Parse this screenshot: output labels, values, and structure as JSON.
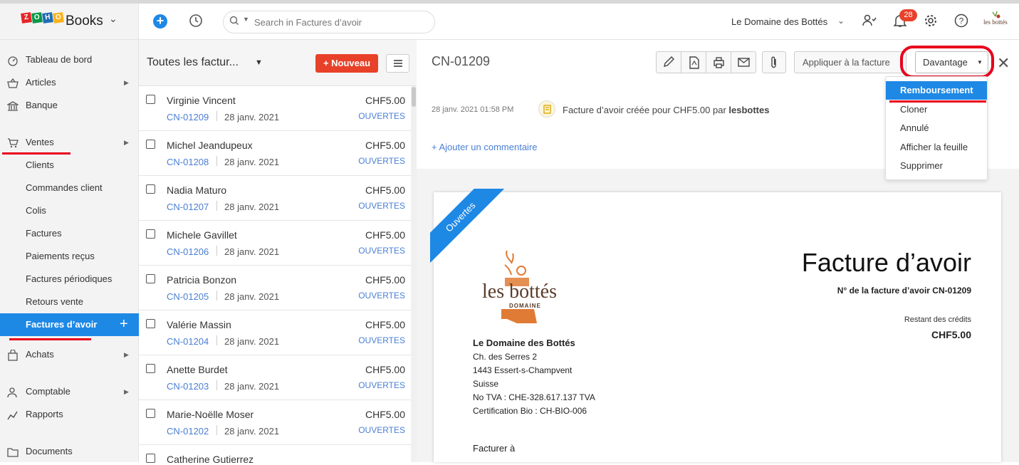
{
  "app": {
    "brand_letters": [
      "Z",
      "O",
      "H",
      "O"
    ],
    "brand_colors": [
      "#e42527",
      "#089949",
      "#226db4",
      "#f9b21d"
    ],
    "product": "Books"
  },
  "topbar": {
    "search_placeholder": "Search in Factures d’avoir",
    "org_name": "Le Domaine des Bottés",
    "notifications": "28",
    "avatar_label": "les bottés"
  },
  "sidebar": {
    "items": [
      {
        "label": "Tableau de bord"
      },
      {
        "label": "Articles"
      },
      {
        "label": "Banque"
      },
      {
        "label": "Ventes"
      },
      {
        "label": "Clients"
      },
      {
        "label": "Commandes client"
      },
      {
        "label": "Colis"
      },
      {
        "label": "Factures"
      },
      {
        "label": "Paiements reçus"
      },
      {
        "label": "Factures périodiques"
      },
      {
        "label": "Retours vente"
      },
      {
        "label": "Factures d’avoir"
      },
      {
        "label": "Achats"
      },
      {
        "label": "Comptable"
      },
      {
        "label": "Rapports"
      },
      {
        "label": "Documents"
      }
    ]
  },
  "list": {
    "title": "Toutes les factur...",
    "new_label": "+ Nouveau",
    "rows": [
      {
        "name": "Virginie Vincent",
        "number": "CN-01209",
        "date": "28 janv. 2021",
        "amount": "CHF5.00",
        "status": "OUVERTES"
      },
      {
        "name": "Michel Jeandupeux",
        "number": "CN-01208",
        "date": "28 janv. 2021",
        "amount": "CHF5.00",
        "status": "OUVERTES"
      },
      {
        "name": "Nadia Maturo",
        "number": "CN-01207",
        "date": "28 janv. 2021",
        "amount": "CHF5.00",
        "status": "OUVERTES"
      },
      {
        "name": "Michele Gavillet",
        "number": "CN-01206",
        "date": "28 janv. 2021",
        "amount": "CHF5.00",
        "status": "OUVERTES"
      },
      {
        "name": "Patricia Bonzon",
        "number": "CN-01205",
        "date": "28 janv. 2021",
        "amount": "CHF5.00",
        "status": "OUVERTES"
      },
      {
        "name": "Valérie Massin",
        "number": "CN-01204",
        "date": "28 janv. 2021",
        "amount": "CHF5.00",
        "status": "OUVERTES"
      },
      {
        "name": "Anette Burdet",
        "number": "CN-01203",
        "date": "28 janv. 2021",
        "amount": "CHF5.00",
        "status": "OUVERTES"
      },
      {
        "name": "Marie-Noëlle Moser",
        "number": "CN-01202",
        "date": "28 janv. 2021",
        "amount": "CHF5.00",
        "status": "OUVERTES"
      },
      {
        "name": "Catherine Gutierrez",
        "number": "",
        "date": "",
        "amount": "",
        "status": ""
      }
    ]
  },
  "detail": {
    "number": "CN-01209",
    "apply_label": "Appliquer à la facture",
    "more_label": "Davantage",
    "more_menu": [
      "Remboursement",
      "Cloner",
      "Annulé",
      "Afficher la feuille",
      "Supprimer"
    ],
    "history": {
      "date": "28 janv. 2021 01:58 PM",
      "text": "Facture d’avoir créée pour CHF5.00 par ",
      "user": "lesbottes"
    },
    "add_comment": "+ Ajouter un commentaire"
  },
  "document": {
    "ribbon": "Ouvertes",
    "title": "Facture d’avoir",
    "number_line": "N° de la facture d’avoir CN-01209",
    "remaining_label": "Restant des crédits",
    "remaining_value": "CHF5.00",
    "logo_text": "les bottés",
    "logo_subtext": "DOMAINE",
    "company": "Le Domaine des Bottés",
    "address": [
      "Ch. des Serres 2",
      "1443 Essert-s-Champvent",
      "Suisse",
      "No TVA : CHE-328.617.137 TVA",
      "Certification Bio : CH-BIO-006"
    ],
    "bill_to": "Facturer à"
  },
  "colors": {
    "accent": "#1e88e5",
    "danger": "#e8412a",
    "highlight": "#e8001c",
    "logo_orange": "#e07b35"
  }
}
